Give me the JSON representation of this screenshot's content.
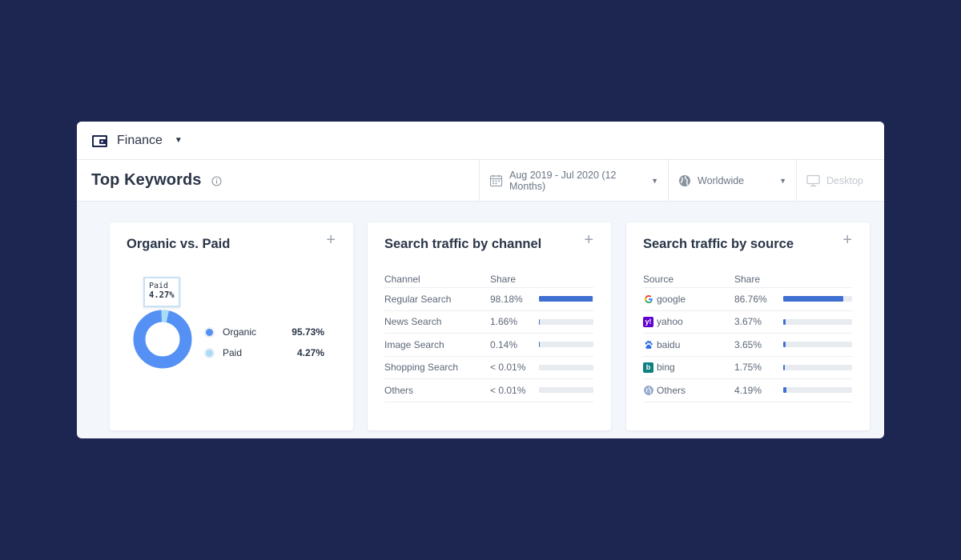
{
  "topbar": {
    "category": "Finance"
  },
  "header": {
    "title": "Top Keywords",
    "date_range": "Aug 2019 - Jul 2020 (12 Months)",
    "region": "Worldwide",
    "device": "Desktop"
  },
  "organic_card": {
    "title": "Organic vs. Paid",
    "tooltip_label": "Paid",
    "tooltip_value": "4.27%",
    "items": [
      {
        "label": "Organic",
        "value": "95.73%",
        "share": 0.9573,
        "color": "#5591f5"
      },
      {
        "label": "Paid",
        "value": "4.27%",
        "share": 0.0427,
        "color": "#a9dcf7"
      }
    ]
  },
  "channel_card": {
    "title": "Search traffic by channel",
    "col_name": "Channel",
    "col_share": "Share",
    "rows": [
      {
        "name": "Regular Search",
        "share": "98.18%",
        "fill": 0.9818
      },
      {
        "name": "News Search",
        "share": "1.66%",
        "fill": 0.0166
      },
      {
        "name": "Image Search",
        "share": "0.14%",
        "fill": 0.0014
      },
      {
        "name": "Shopping Search",
        "share": "< 0.01%",
        "fill": 0
      },
      {
        "name": "Others",
        "share": "< 0.01%",
        "fill": 0
      }
    ]
  },
  "source_card": {
    "title": "Search traffic by source",
    "col_name": "Source",
    "col_share": "Share",
    "rows": [
      {
        "name": "google",
        "share": "86.76%",
        "fill": 0.8676,
        "icon": "google-icon"
      },
      {
        "name": "yahoo",
        "share": "3.67%",
        "fill": 0.0367,
        "icon": "yahoo-icon"
      },
      {
        "name": "baidu",
        "share": "3.65%",
        "fill": 0.0365,
        "icon": "baidu-icon"
      },
      {
        "name": "bing",
        "share": "1.75%",
        "fill": 0.0175,
        "icon": "bing-icon"
      },
      {
        "name": "Others",
        "share": "4.19%",
        "fill": 0.0419,
        "icon": "globe-icon"
      }
    ]
  },
  "colors": {
    "accent": "#3e6fd1",
    "background": "#1c2651"
  }
}
